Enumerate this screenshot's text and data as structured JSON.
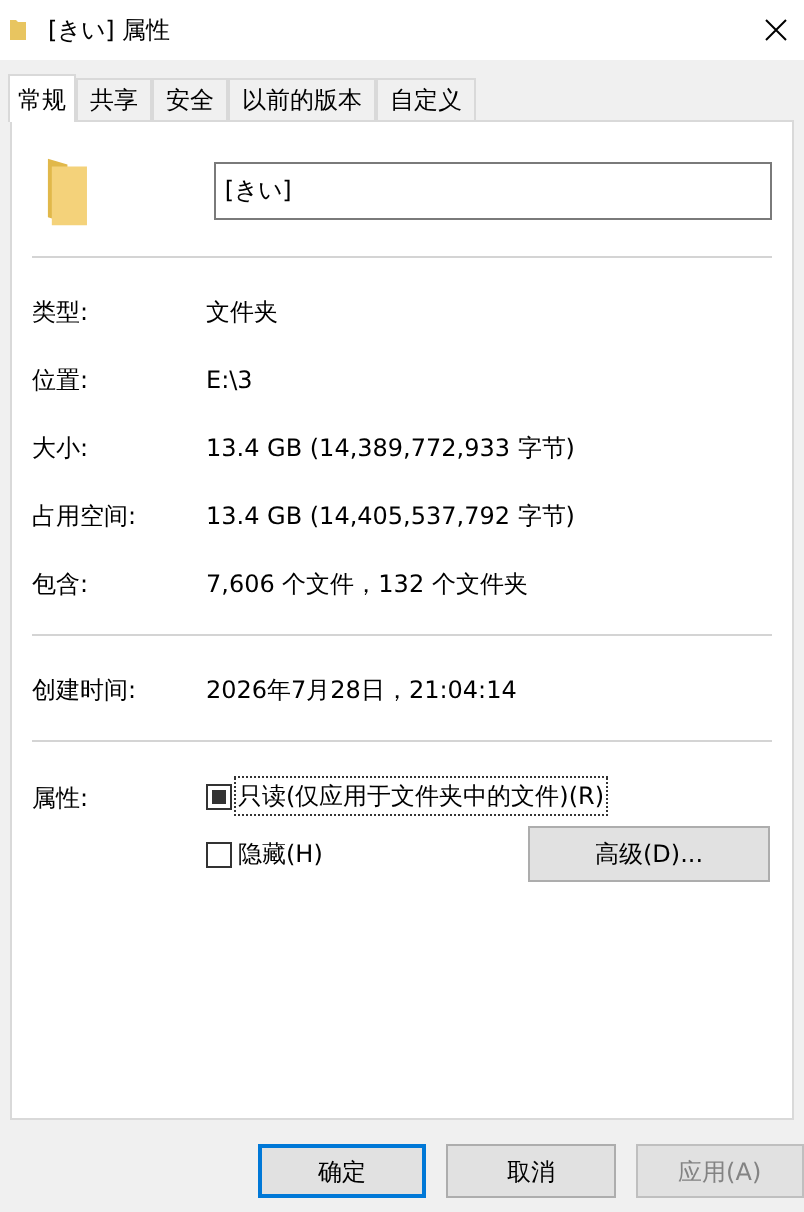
{
  "window": {
    "title": "[きい] 属性"
  },
  "tabs": [
    {
      "label": "常规",
      "selected": true
    },
    {
      "label": "共享",
      "selected": false
    },
    {
      "label": "安全",
      "selected": false
    },
    {
      "label": "以前的版本",
      "selected": false
    },
    {
      "label": "自定义",
      "selected": false
    }
  ],
  "name_field": {
    "value": "[きい]"
  },
  "info_groups": [
    [
      {
        "label": "类型:",
        "value": "文件夹"
      },
      {
        "label": "位置:",
        "value": "E:\\3"
      },
      {
        "label": "大小:",
        "value": "13.4 GB (14,389,772,933 字节)"
      },
      {
        "label": "占用空间:",
        "value": "13.4 GB (14,405,537,792 字节)"
      },
      {
        "label": "包含:",
        "value": "7,606 个文件，132 个文件夹"
      }
    ],
    [
      {
        "label": "创建时间:",
        "value": "2026年7月28日，21:04:14"
      }
    ]
  ],
  "attributes": {
    "label": "属性:",
    "options": [
      {
        "label": "只读(仅应用于文件夹中的文件)(R)",
        "checked": false,
        "indeterminate": true,
        "focused": true
      },
      {
        "label": "隐藏(H)",
        "checked": false,
        "indeterminate": false,
        "focused": false
      }
    ],
    "advanced_button": "高级(D)..."
  },
  "buttons": [
    {
      "label": "确定",
      "default": true,
      "disabled": false
    },
    {
      "label": "取消",
      "default": false,
      "disabled": false
    },
    {
      "label": "应用(A)",
      "default": false,
      "disabled": true
    }
  ]
}
